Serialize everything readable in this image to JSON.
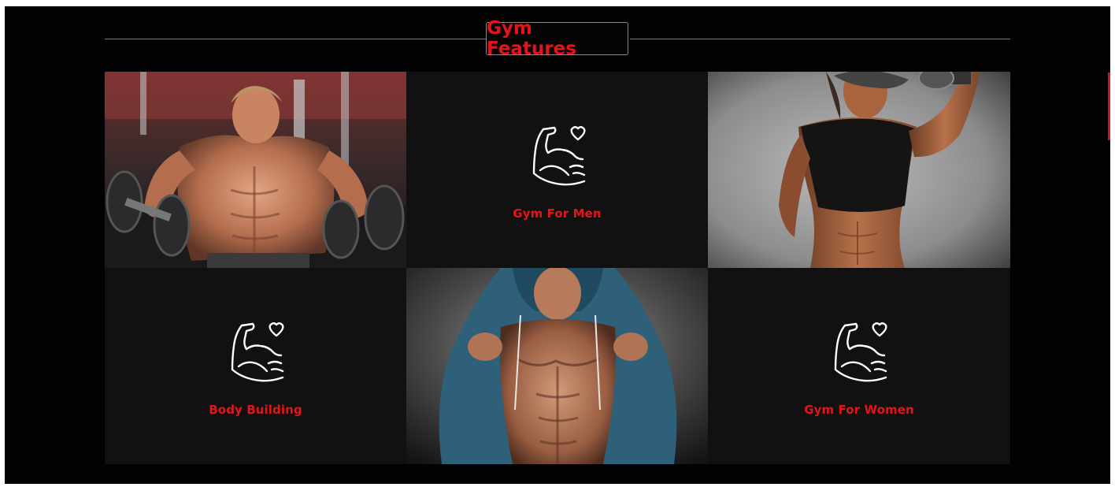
{
  "section": {
    "title": "Gym Features"
  },
  "features": [
    {
      "label": "Gym For Men",
      "icon": "muscle-heart-icon"
    },
    {
      "label": "Body Building",
      "icon": "muscle-heart-icon"
    },
    {
      "label": "Gym For Women",
      "icon": "muscle-heart-icon"
    }
  ],
  "photos": [
    {
      "name": "man-lifting-dumbbells-photo"
    },
    {
      "name": "woman-lifting-dumbbell-photo"
    },
    {
      "name": "man-in-hoodie-photo"
    }
  ],
  "colors": {
    "accent": "#e5141b",
    "page_background": "#020202",
    "card_background": "#111111",
    "icon_stroke": "#ffffff"
  }
}
